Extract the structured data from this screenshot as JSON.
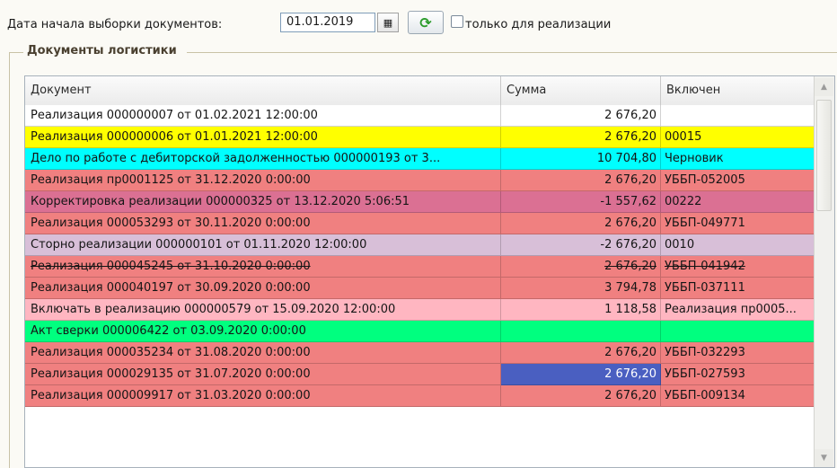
{
  "filter": {
    "date_label": "Дата начала выборки документов:",
    "date_value": "01.01.2019",
    "calendar_icon": "calendar-icon",
    "refresh_icon": "refresh-icon",
    "only_sales_label": "только для реализации",
    "only_sales_checked": false
  },
  "group": {
    "title": "Документы логистики"
  },
  "table": {
    "columns": [
      "Документ",
      "Сумма",
      "Включен"
    ],
    "rows": [
      {
        "doc": "Реализация 000000007 от 01.02.2021 12:00:00",
        "sum": "2 676,20",
        "included": "",
        "bg": "#ffffff",
        "strike": false,
        "selected_sum": false
      },
      {
        "doc": "Реализация 000000006 от 01.01.2021 12:00:00",
        "sum": "2 676,20",
        "included": "00015",
        "bg": "#ffff00",
        "strike": false,
        "selected_sum": false
      },
      {
        "doc": "Дело по работе с дебиторской задолженностью 000000193 от 3...",
        "sum": "10 704,80",
        "included": "Черновик",
        "bg": "#00ffff",
        "strike": false,
        "selected_sum": false
      },
      {
        "doc": "Реализация пр0001125 от 31.12.2020 0:00:00",
        "sum": "2 676,20",
        "included": "УББП-052005",
        "bg": "#f08080",
        "strike": false,
        "selected_sum": false
      },
      {
        "doc": "Корректировка реализации 000000325 от 13.12.2020 5:06:51",
        "sum": "-1 557,62",
        "included": "00222",
        "bg": "#db7093",
        "strike": false,
        "selected_sum": false
      },
      {
        "doc": "Реализация 000053293 от 30.11.2020 0:00:00",
        "sum": "2 676,20",
        "included": "УББП-049771",
        "bg": "#f08080",
        "strike": false,
        "selected_sum": false
      },
      {
        "doc": "Сторно реализации 000000101 от 01.11.2020 12:00:00",
        "sum": "-2 676,20",
        "included": "0010",
        "bg": "#d8bfd8",
        "strike": false,
        "selected_sum": false
      },
      {
        "doc": "Реализация 000045245 от 31.10.2020 0:00:00",
        "sum": "2 676,20",
        "included": "УББП-041942",
        "bg": "#f08080",
        "strike": true,
        "selected_sum": false
      },
      {
        "doc": "Реализация 000040197 от 30.09.2020 0:00:00",
        "sum": "3 794,78",
        "included": "УББП-037111",
        "bg": "#f08080",
        "strike": false,
        "selected_sum": false
      },
      {
        "doc": "Включать в реализацию 000000579 от 15.09.2020 12:00:00",
        "sum": "1 118,58",
        "included": "Реализация пр0005...",
        "bg": "#ffb6c1",
        "strike": false,
        "selected_sum": false
      },
      {
        "doc": "Акт сверки 000006422 от 03.09.2020 0:00:00",
        "sum": "",
        "included": "",
        "bg": "#00ff7f",
        "strike": false,
        "selected_sum": false
      },
      {
        "doc": "Реализация 000035234 от 31.08.2020 0:00:00",
        "sum": "2 676,20",
        "included": "УББП-032293",
        "bg": "#f08080",
        "strike": false,
        "selected_sum": false
      },
      {
        "doc": "Реализация 000029135 от 31.07.2020 0:00:00",
        "sum": "2 676,20",
        "included": "УББП-027593",
        "bg": "#f08080",
        "strike": false,
        "selected_sum": true
      },
      {
        "doc": "Реализация 000009917 от 31.03.2020 0:00:00",
        "sum": "2 676,20",
        "included": "УББП-009134",
        "bg": "#f08080",
        "strike": false,
        "selected_sum": false
      }
    ]
  },
  "colors": {
    "selection": "#4a5fc1",
    "selection_text": "#ffffff"
  }
}
